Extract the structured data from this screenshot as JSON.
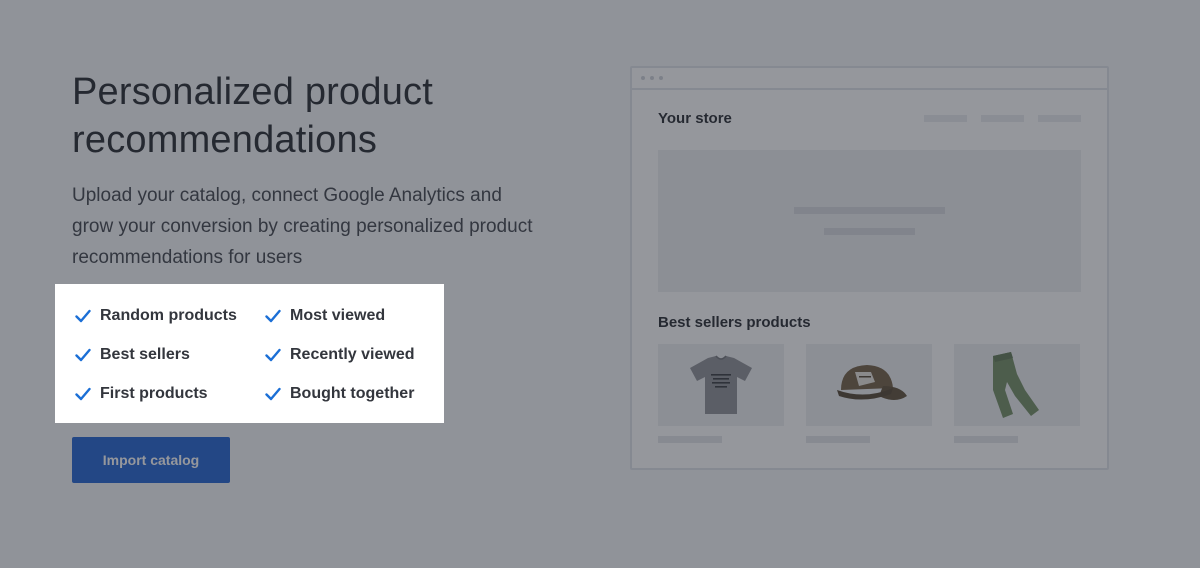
{
  "hero": {
    "title": "Personalized product recommendations",
    "description": "Upload your catalog, connect Google Analytics and grow your conversion by creating personalized product recommendations for users"
  },
  "features": {
    "items": [
      {
        "label": "Random products"
      },
      {
        "label": "Most viewed"
      },
      {
        "label": "Best sellers"
      },
      {
        "label": "Recently viewed"
      },
      {
        "label": "First products"
      },
      {
        "label": "Bought together"
      }
    ]
  },
  "actions": {
    "import_label": "Import catalog"
  },
  "store_mock": {
    "store_title": "Your store",
    "best_sellers_title": "Best sellers products",
    "products": [
      {
        "icon": "tshirt-icon"
      },
      {
        "icon": "cap-icon"
      },
      {
        "icon": "pants-icon"
      }
    ]
  },
  "colors": {
    "accent": "#1b5fd1",
    "check": "#1b6fd6",
    "overlay": "#2c303a"
  }
}
